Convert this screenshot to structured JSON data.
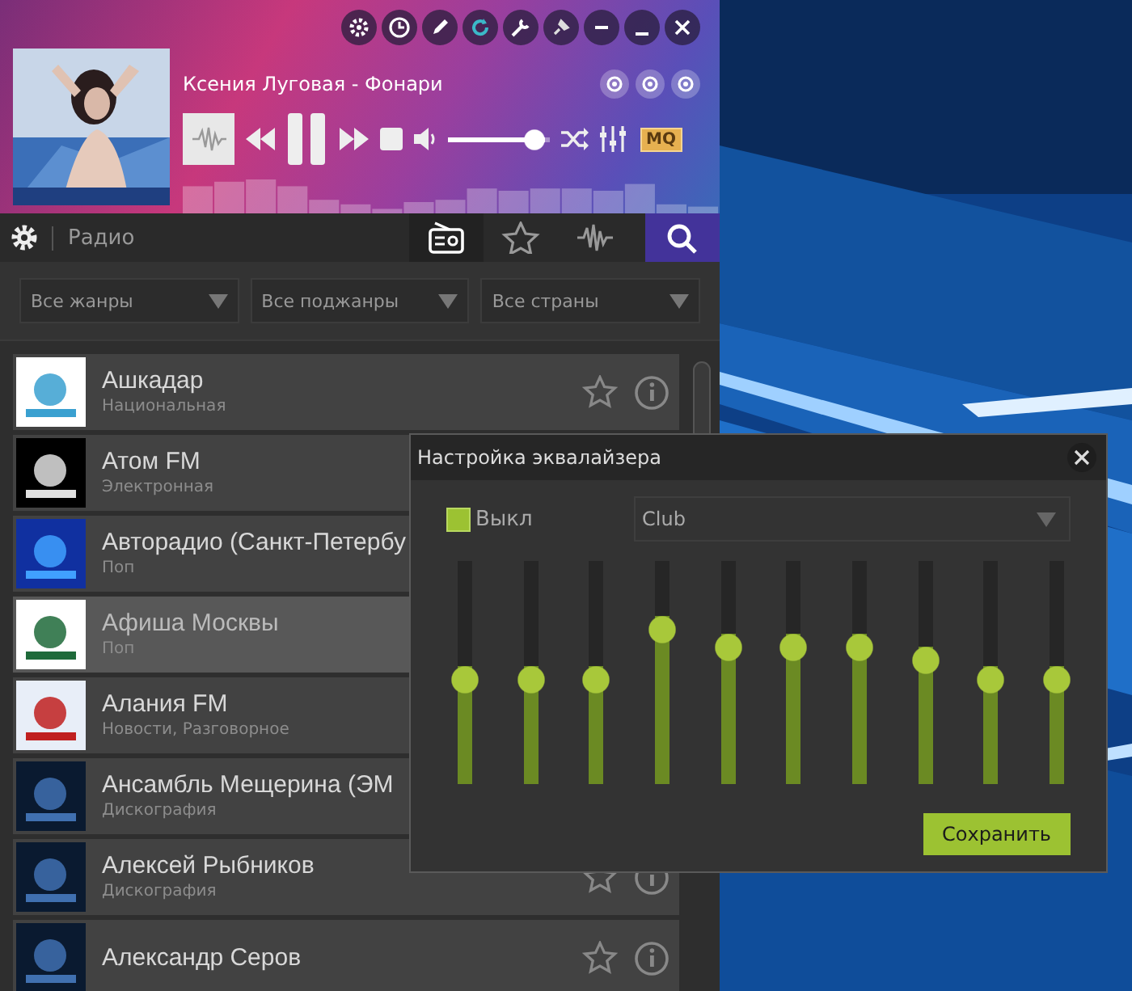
{
  "player": {
    "track_title": "Ксения Луговая - Фонари",
    "volume": {
      "level": 0.95
    },
    "quality_badge": "MQ"
  },
  "toolbar": {
    "section_title": "Радио",
    "tabs": [
      {
        "kind": "radio",
        "selected": true
      },
      {
        "kind": "favorites",
        "selected": false
      },
      {
        "kind": "wave",
        "selected": false
      },
      {
        "kind": "search",
        "selected": false
      }
    ]
  },
  "filters": [
    {
      "value": "Все жанры"
    },
    {
      "value": "Все поджанры"
    },
    {
      "value": "Все страны"
    }
  ],
  "stations": [
    {
      "name": "Ашкадар",
      "genre": "Национальная",
      "selected": false,
      "actions": true
    },
    {
      "name": "Атом FM",
      "genre": "Электронная",
      "selected": false,
      "actions": false
    },
    {
      "name": "Авторадио (Санкт-Петербу",
      "genre": "Поп",
      "selected": false,
      "actions": false
    },
    {
      "name": "Афиша Москвы",
      "genre": "Поп",
      "selected": true,
      "actions": false
    },
    {
      "name": "Алания FM",
      "genre": "Новости, Разговорное",
      "selected": false,
      "actions": false
    },
    {
      "name": "Ансамбль Мещерина (ЭМ",
      "genre": "Дискография",
      "selected": false,
      "actions": false
    },
    {
      "name": "Алексей Рыбников",
      "genre": "Дискография",
      "selected": false,
      "actions": true
    },
    {
      "name": "Александр Серов",
      "selected": false,
      "actions": true
    }
  ],
  "equalizer": {
    "title": "Настройка эквалайзера",
    "enabled_checkbox": {
      "label": "Выкл",
      "checked": true
    },
    "preset": "Club",
    "bands": [
      {
        "level": 0.5
      },
      {
        "level": 0.5
      },
      {
        "level": 0.5
      },
      {
        "level": 0.74
      },
      {
        "level": 0.65
      },
      {
        "level": 0.65
      },
      {
        "level": 0.65
      },
      {
        "level": 0.59
      },
      {
        "level": 0.5
      },
      {
        "level": 0.5
      }
    ],
    "save_button": "Сохранить"
  }
}
